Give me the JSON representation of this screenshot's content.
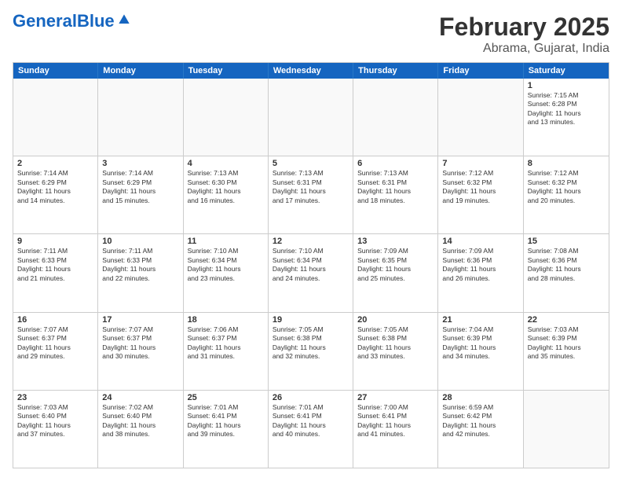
{
  "header": {
    "logo_general": "General",
    "logo_blue": "Blue",
    "month_title": "February 2025",
    "location": "Abrama, Gujarat, India"
  },
  "weekdays": [
    "Sunday",
    "Monday",
    "Tuesday",
    "Wednesday",
    "Thursday",
    "Friday",
    "Saturday"
  ],
  "rows": [
    [
      {
        "day": "",
        "info": ""
      },
      {
        "day": "",
        "info": ""
      },
      {
        "day": "",
        "info": ""
      },
      {
        "day": "",
        "info": ""
      },
      {
        "day": "",
        "info": ""
      },
      {
        "day": "",
        "info": ""
      },
      {
        "day": "1",
        "info": "Sunrise: 7:15 AM\nSunset: 6:28 PM\nDaylight: 11 hours\nand 13 minutes."
      }
    ],
    [
      {
        "day": "2",
        "info": "Sunrise: 7:14 AM\nSunset: 6:29 PM\nDaylight: 11 hours\nand 14 minutes."
      },
      {
        "day": "3",
        "info": "Sunrise: 7:14 AM\nSunset: 6:29 PM\nDaylight: 11 hours\nand 15 minutes."
      },
      {
        "day": "4",
        "info": "Sunrise: 7:13 AM\nSunset: 6:30 PM\nDaylight: 11 hours\nand 16 minutes."
      },
      {
        "day": "5",
        "info": "Sunrise: 7:13 AM\nSunset: 6:31 PM\nDaylight: 11 hours\nand 17 minutes."
      },
      {
        "day": "6",
        "info": "Sunrise: 7:13 AM\nSunset: 6:31 PM\nDaylight: 11 hours\nand 18 minutes."
      },
      {
        "day": "7",
        "info": "Sunrise: 7:12 AM\nSunset: 6:32 PM\nDaylight: 11 hours\nand 19 minutes."
      },
      {
        "day": "8",
        "info": "Sunrise: 7:12 AM\nSunset: 6:32 PM\nDaylight: 11 hours\nand 20 minutes."
      }
    ],
    [
      {
        "day": "9",
        "info": "Sunrise: 7:11 AM\nSunset: 6:33 PM\nDaylight: 11 hours\nand 21 minutes."
      },
      {
        "day": "10",
        "info": "Sunrise: 7:11 AM\nSunset: 6:33 PM\nDaylight: 11 hours\nand 22 minutes."
      },
      {
        "day": "11",
        "info": "Sunrise: 7:10 AM\nSunset: 6:34 PM\nDaylight: 11 hours\nand 23 minutes."
      },
      {
        "day": "12",
        "info": "Sunrise: 7:10 AM\nSunset: 6:34 PM\nDaylight: 11 hours\nand 24 minutes."
      },
      {
        "day": "13",
        "info": "Sunrise: 7:09 AM\nSunset: 6:35 PM\nDaylight: 11 hours\nand 25 minutes."
      },
      {
        "day": "14",
        "info": "Sunrise: 7:09 AM\nSunset: 6:36 PM\nDaylight: 11 hours\nand 26 minutes."
      },
      {
        "day": "15",
        "info": "Sunrise: 7:08 AM\nSunset: 6:36 PM\nDaylight: 11 hours\nand 28 minutes."
      }
    ],
    [
      {
        "day": "16",
        "info": "Sunrise: 7:07 AM\nSunset: 6:37 PM\nDaylight: 11 hours\nand 29 minutes."
      },
      {
        "day": "17",
        "info": "Sunrise: 7:07 AM\nSunset: 6:37 PM\nDaylight: 11 hours\nand 30 minutes."
      },
      {
        "day": "18",
        "info": "Sunrise: 7:06 AM\nSunset: 6:37 PM\nDaylight: 11 hours\nand 31 minutes."
      },
      {
        "day": "19",
        "info": "Sunrise: 7:05 AM\nSunset: 6:38 PM\nDaylight: 11 hours\nand 32 minutes."
      },
      {
        "day": "20",
        "info": "Sunrise: 7:05 AM\nSunset: 6:38 PM\nDaylight: 11 hours\nand 33 minutes."
      },
      {
        "day": "21",
        "info": "Sunrise: 7:04 AM\nSunset: 6:39 PM\nDaylight: 11 hours\nand 34 minutes."
      },
      {
        "day": "22",
        "info": "Sunrise: 7:03 AM\nSunset: 6:39 PM\nDaylight: 11 hours\nand 35 minutes."
      }
    ],
    [
      {
        "day": "23",
        "info": "Sunrise: 7:03 AM\nSunset: 6:40 PM\nDaylight: 11 hours\nand 37 minutes."
      },
      {
        "day": "24",
        "info": "Sunrise: 7:02 AM\nSunset: 6:40 PM\nDaylight: 11 hours\nand 38 minutes."
      },
      {
        "day": "25",
        "info": "Sunrise: 7:01 AM\nSunset: 6:41 PM\nDaylight: 11 hours\nand 39 minutes."
      },
      {
        "day": "26",
        "info": "Sunrise: 7:01 AM\nSunset: 6:41 PM\nDaylight: 11 hours\nand 40 minutes."
      },
      {
        "day": "27",
        "info": "Sunrise: 7:00 AM\nSunset: 6:41 PM\nDaylight: 11 hours\nand 41 minutes."
      },
      {
        "day": "28",
        "info": "Sunrise: 6:59 AM\nSunset: 6:42 PM\nDaylight: 11 hours\nand 42 minutes."
      },
      {
        "day": "",
        "info": ""
      }
    ]
  ]
}
